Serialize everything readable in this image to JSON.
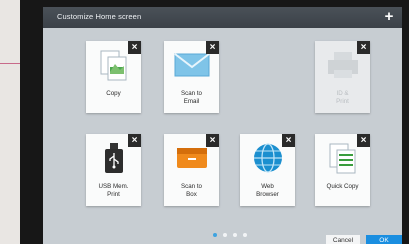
{
  "title": "Customize Home screen",
  "add_label": "+",
  "tiles": [
    {
      "label": "Copy",
      "icon": "copy-icon"
    },
    {
      "label": "Scan to\nEmail",
      "icon": "email-icon"
    },
    {
      "label": "ID &\nPrint",
      "icon": "printer-icon",
      "disabled": true
    },
    {
      "label": "USB Mem.\nPrint",
      "icon": "usb-icon"
    },
    {
      "label": "Scan to\nBox",
      "icon": "box-icon"
    },
    {
      "label": "Web\nBrowser",
      "icon": "globe-icon"
    },
    {
      "label": "Quick Copy",
      "icon": "quick-copy-icon"
    }
  ],
  "close_label": "×",
  "pagination": {
    "count": 4,
    "active": 0
  },
  "buttons": {
    "cancel": "Cancel",
    "ok": "OK"
  },
  "colors": {
    "accent": "#1a8ee0",
    "titlebar": "#3f464d",
    "screen": "#c7cdd2"
  }
}
